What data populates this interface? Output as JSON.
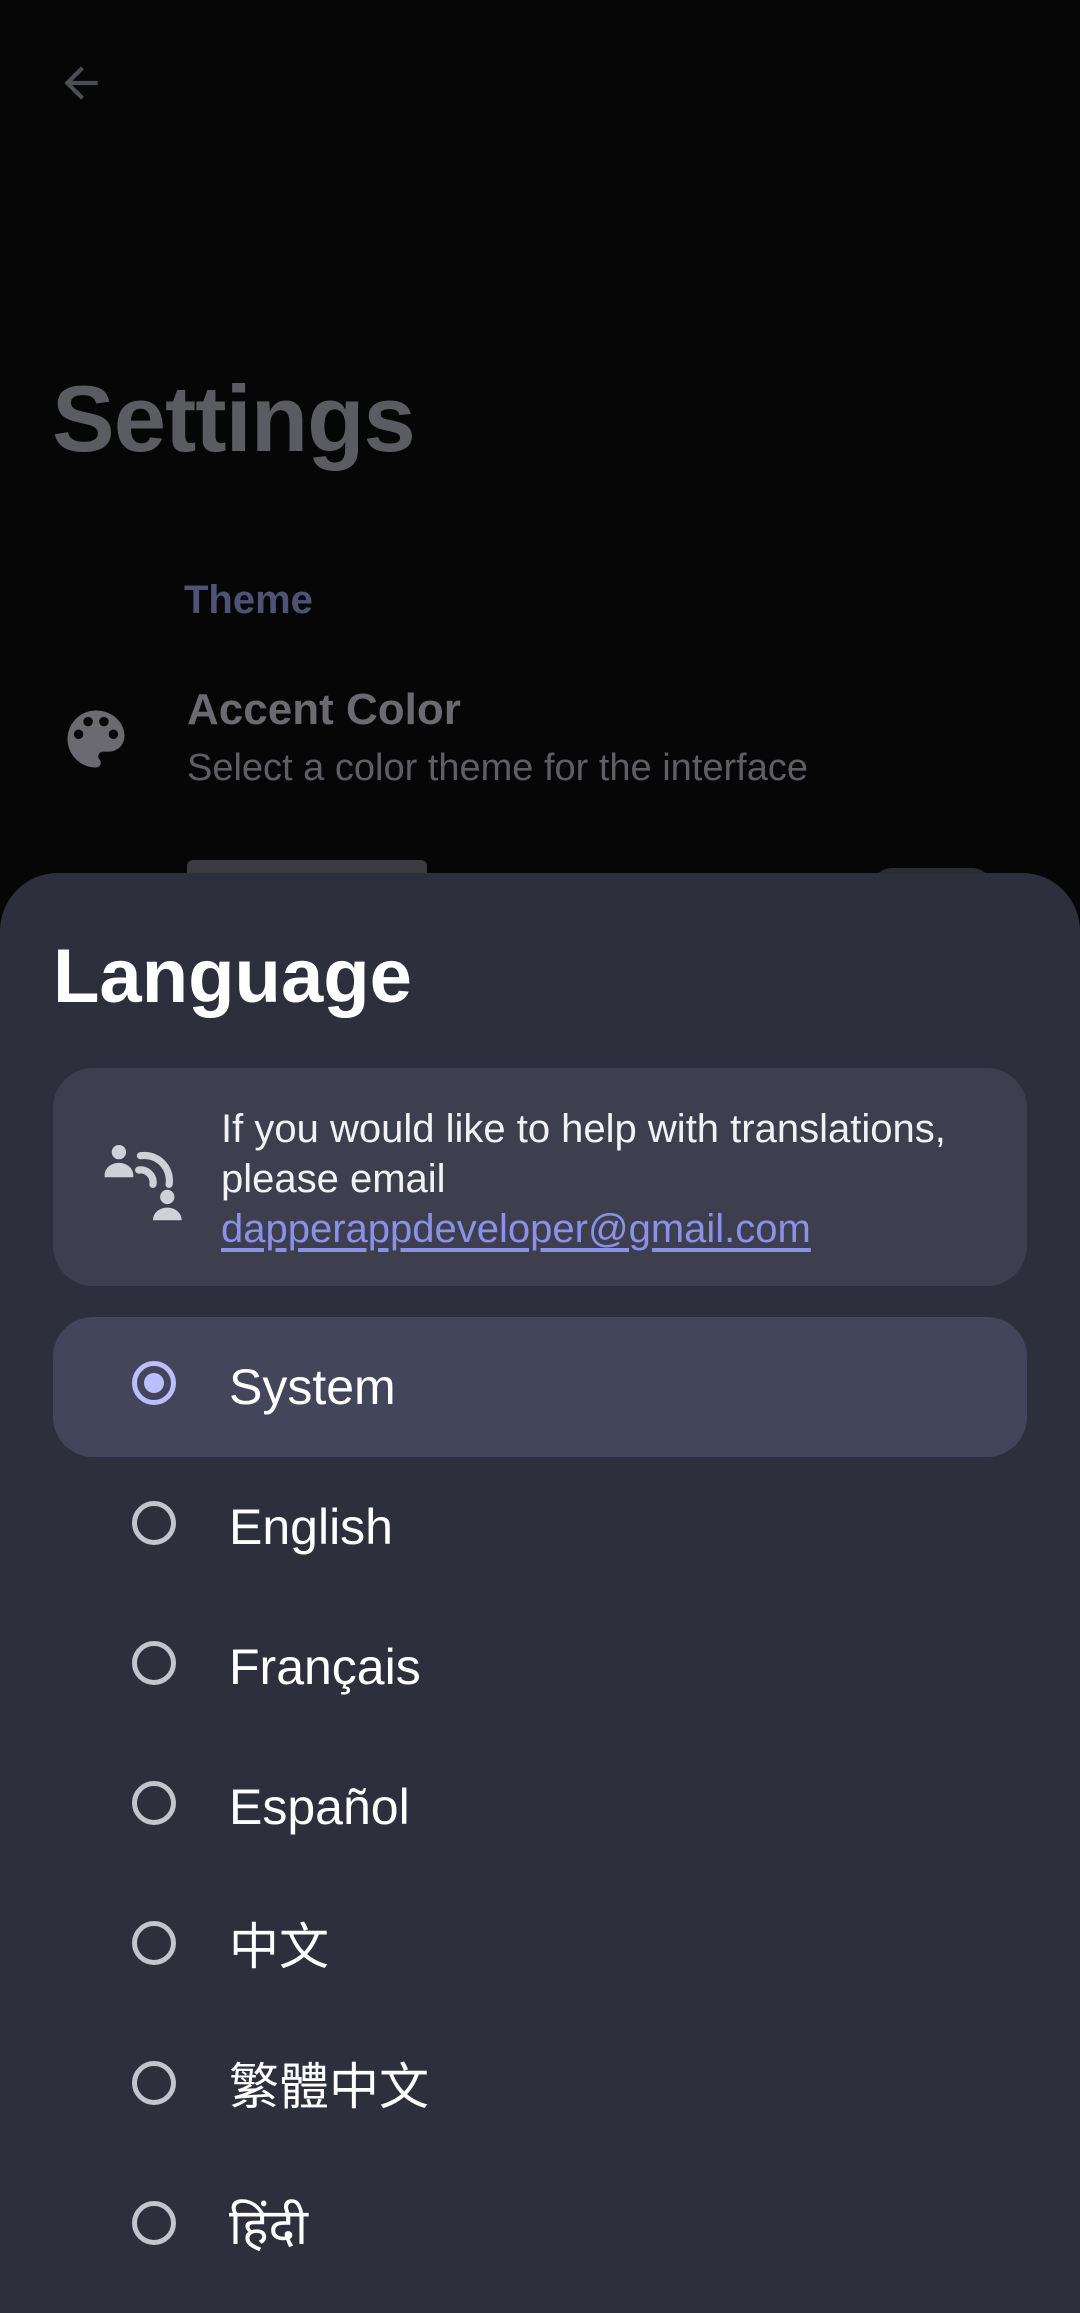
{
  "background": {
    "title": "Settings",
    "section_header": "Theme",
    "accent_color": {
      "title": "Accent Color",
      "subtitle": "Select a color theme for the interface"
    }
  },
  "sheet": {
    "title": "Language",
    "info": {
      "line1": "If you would like to help with translations,",
      "line2": "please email",
      "email": "dapperappdeveloper@gmail.com"
    },
    "options": [
      {
        "label": "System",
        "selected": true
      },
      {
        "label": "English",
        "selected": false
      },
      {
        "label": "Français",
        "selected": false
      },
      {
        "label": "Español",
        "selected": false
      },
      {
        "label": "中文",
        "selected": false
      },
      {
        "label": "繁體中文",
        "selected": false
      },
      {
        "label": "हिंदी",
        "selected": false
      }
    ]
  },
  "colors": {
    "sheet_background": "#2e2f3c",
    "card_background": "#3d3f4f",
    "selected_background": "#43455a",
    "accent": "#bcbfff",
    "link": "#8b90e8"
  },
  "icons": {
    "back": "arrow-left-icon",
    "accent_color": "palette-icon",
    "translate": "translate-icon"
  }
}
